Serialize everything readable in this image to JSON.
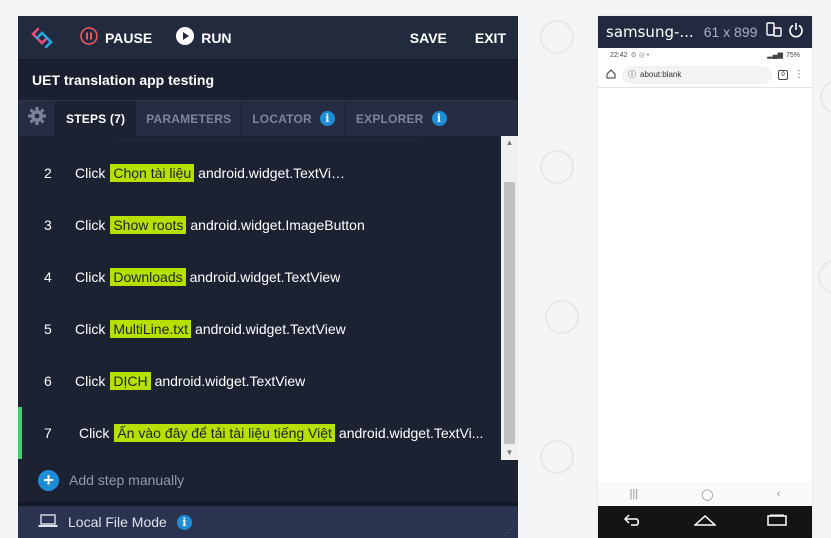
{
  "toolbar": {
    "pause_label": "PAUSE",
    "run_label": "RUN",
    "save_label": "SAVE",
    "exit_label": "EXIT"
  },
  "project": {
    "title": "UET translation app testing"
  },
  "tabs": [
    {
      "label": "STEPS (7)",
      "active": true,
      "info": false
    },
    {
      "label": "PARAMETERS",
      "active": false,
      "info": false
    },
    {
      "label": "LOCATOR",
      "active": false,
      "info": true
    },
    {
      "label": "EXPLORER",
      "active": false,
      "info": true
    }
  ],
  "steps": [
    {
      "number": "2",
      "action": "Click",
      "target": "Chọn tài liệu",
      "widget": "android.widget.TextView"
    },
    {
      "number": "3",
      "action": "Click",
      "target": "Show roots",
      "widget": "android.widget.ImageButton"
    },
    {
      "number": "4",
      "action": "Click",
      "target": "Downloads",
      "widget": "android.widget.TextView"
    },
    {
      "number": "5",
      "action": "Click",
      "target": "MultiLine.txt",
      "widget": "android.widget.TextView"
    },
    {
      "number": "6",
      "action": "Click",
      "target": "DỊCH",
      "widget": "android.widget.TextView"
    },
    {
      "number": "7",
      "action": "Click",
      "target": "Ấn vào đây để tải tài liệu tiếng Việt",
      "widget": "android.widget.TextVi..."
    }
  ],
  "add_step_label": "Add step manually",
  "footer": {
    "mode_label": "Local File Mode"
  },
  "device": {
    "name": "samsung-...",
    "resolution": "61 x 899",
    "status_time": "22:42",
    "status_battery": "75%",
    "url": "about:blank",
    "tab_count": "0"
  },
  "colors": {
    "accent_highlight": "#b6e000",
    "active_step_marker": "#3fcf6d",
    "info_blue": "#1f8dd6",
    "panel_bg": "#1d2233"
  }
}
